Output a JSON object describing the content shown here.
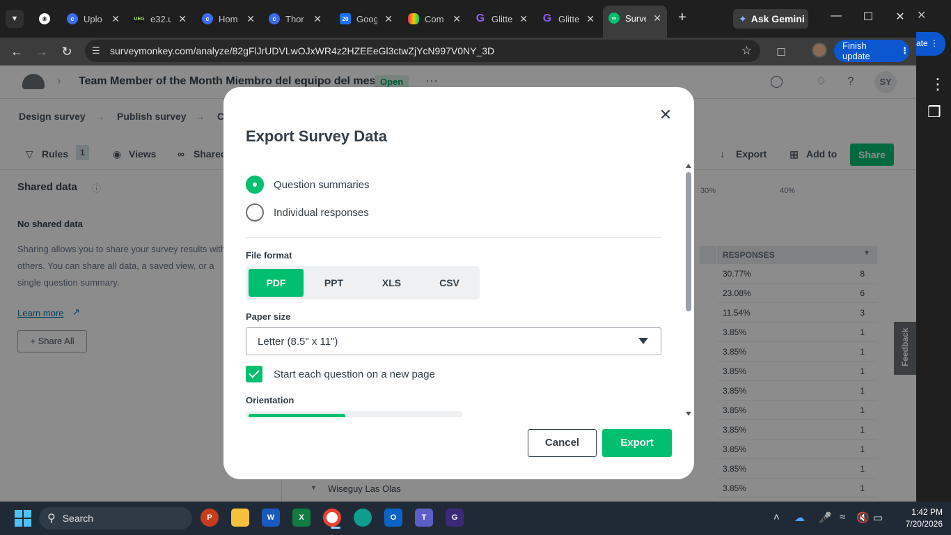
{
  "browser": {
    "tabs": [
      {
        "title": "Uplo",
        "icon": "copilot-icon"
      },
      {
        "title": "e32.u",
        "icon": "ueg-icon"
      },
      {
        "title": "Hom",
        "icon": "copilot-icon"
      },
      {
        "title": "Thor",
        "icon": "copilot-icon"
      },
      {
        "title": "Goog",
        "icon": "calendar-icon"
      },
      {
        "title": "Com",
        "icon": "monday-icon"
      },
      {
        "title": "Glitte",
        "icon": "glitter-icon"
      },
      {
        "title": "Glitte",
        "icon": "glitter-icon"
      },
      {
        "title": "Surve",
        "icon": "surveymonkey-icon"
      }
    ],
    "ask_gemini": "Ask Gemini",
    "url": "surveymonkey.com/analyze/82gFlJrUDVLwOJxWR4z2HZEEeGl3ctwZjYcN997V0NY_3D",
    "finish_update": "Finish update",
    "edge_text": "ate"
  },
  "page": {
    "survey_title": "Team Member of the Month Miembro del equipo del mes",
    "status_badge": "Open",
    "steps": [
      "Design survey",
      "Publish survey",
      "C"
    ],
    "subbar": {
      "rules": "Rules",
      "rules_count": "1",
      "views": "Views",
      "shared": "Shared",
      "export": "Export",
      "add_to": "Add to",
      "share": "Share"
    },
    "sidebar": {
      "heading": "Shared data",
      "no_shared": "No shared data",
      "description": "Sharing allows you to share your survey results with others. You can share all data, a saved view, or a single question summary.",
      "learn_more": "Learn more",
      "share_all": "Share All"
    },
    "axis_ticks": [
      "30%",
      "40%"
    ],
    "responses_header": "RESPONSES",
    "responses": [
      {
        "pct": "30.77%",
        "n": "8"
      },
      {
        "pct": "23.08%",
        "n": "6"
      },
      {
        "pct": "11.54%",
        "n": "3"
      },
      {
        "pct": "3.85%",
        "n": "1"
      },
      {
        "pct": "3.85%",
        "n": "1"
      },
      {
        "pct": "3.85%",
        "n": "1"
      },
      {
        "pct": "3.85%",
        "n": "1"
      },
      {
        "pct": "3.85%",
        "n": "1"
      },
      {
        "pct": "3.85%",
        "n": "1"
      },
      {
        "pct": "3.85%",
        "n": "1"
      },
      {
        "pct": "3.85%",
        "n": "1"
      },
      {
        "pct": "3.85%",
        "n": "1"
      }
    ],
    "last_row_label": "Wiseguy Las Olas",
    "feedback": "Feedback"
  },
  "modal": {
    "title": "Export Survey Data",
    "export_type": {
      "options": [
        "Question summaries",
        "Individual responses"
      ],
      "selected": "Question summaries"
    },
    "file_format": {
      "label": "File format",
      "options": [
        "PDF",
        "PPT",
        "XLS",
        "CSV"
      ],
      "selected": "PDF"
    },
    "paper_size": {
      "label": "Paper size",
      "value": "Letter (8.5\" x 11\")"
    },
    "new_page_checkbox": {
      "label": "Start each question on a new page",
      "checked": true
    },
    "orientation_label": "Orientation",
    "cancel": "Cancel",
    "export": "Export",
    "accent_color": "#00bf6f"
  },
  "taskbar": {
    "search": "Search",
    "time": "1:42 PM",
    "date": "7/20/2026"
  }
}
